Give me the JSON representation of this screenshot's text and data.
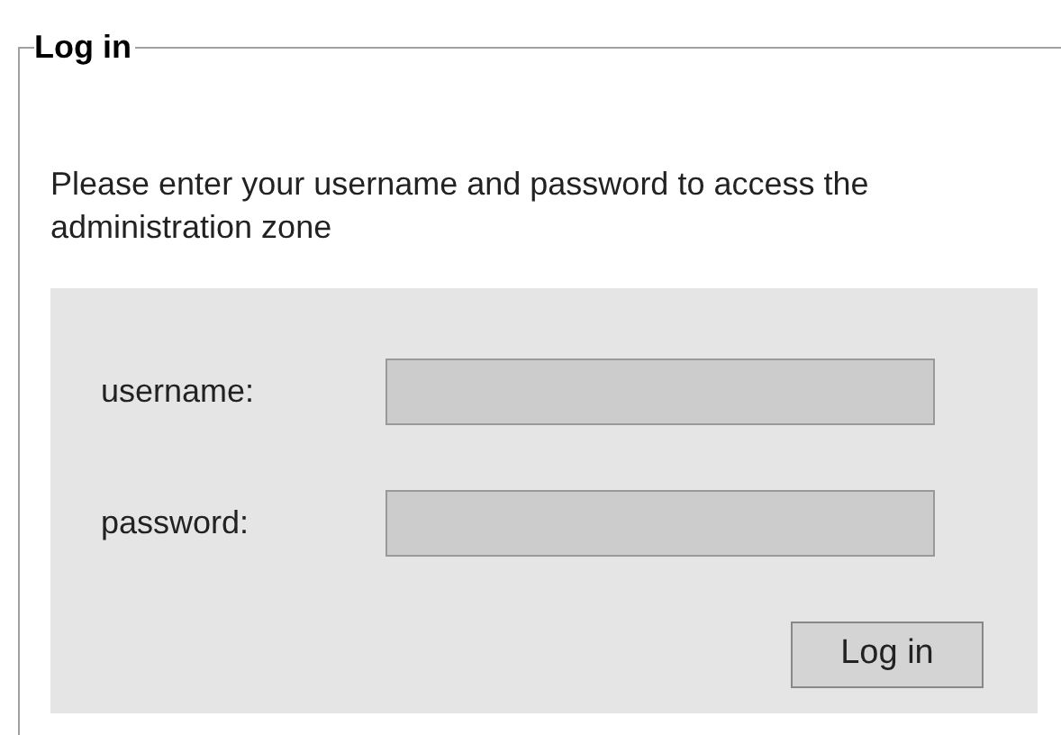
{
  "panel": {
    "legend": "Log in",
    "message": "Please enter your username and password to access the administration zone"
  },
  "fields": [
    {
      "label": "username:"
    },
    {
      "label": "password:"
    }
  ],
  "submit": "Log in"
}
